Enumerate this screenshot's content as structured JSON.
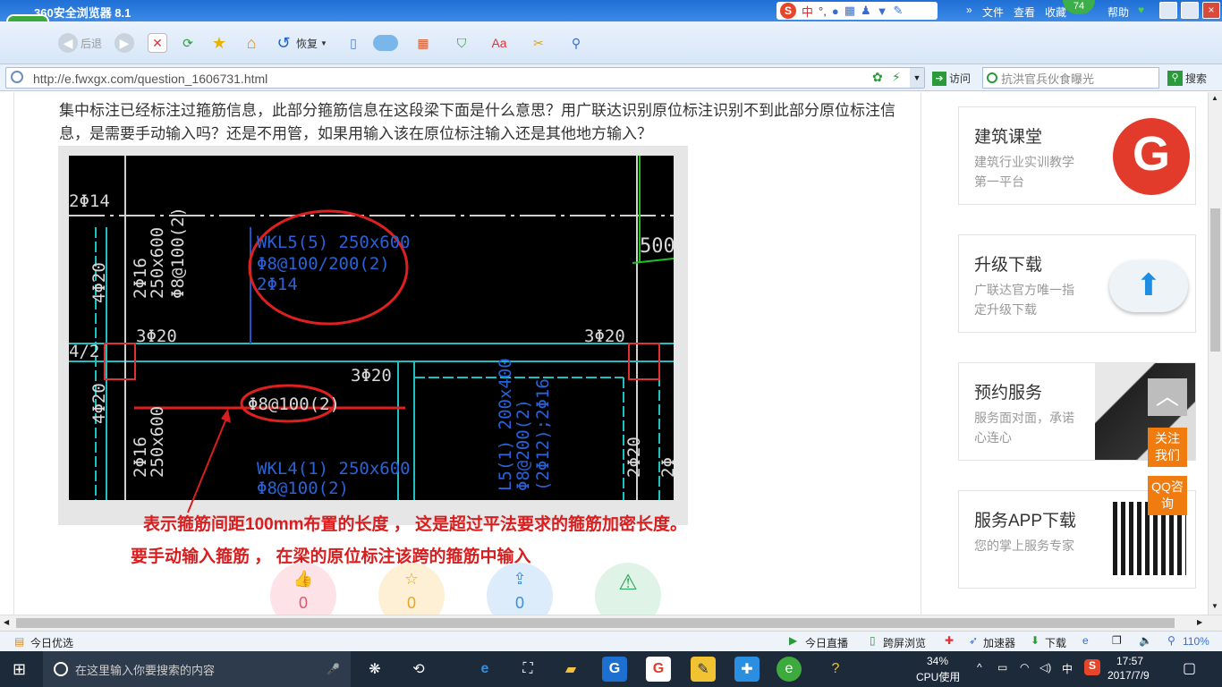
{
  "browser": {
    "title": "360安全浏览器 8.1",
    "menu": [
      "文件",
      "查看",
      "收藏",
      "帮助"
    ],
    "notification_count": "74",
    "ime_label": "中",
    "toolbar": {
      "back": "后退",
      "restore": "恢复"
    },
    "url": "http://e.fwxgx.com/question_1606731.html",
    "visit": "访问",
    "search_placeholder": "抗洪官兵伙食曝光",
    "search_button": "搜索"
  },
  "question": {
    "text": "集中标注已经标注过箍筋信息，此部分箍筋信息在这段梁下面是什么意思？用广联达识别原位标注识别不到此部分原位标注信息，是需要手动输入吗？还是不用管，如果用输入该在原位标注输入还是其他地方输入？"
  },
  "cad": {
    "labels": {
      "l_2d14_top": "2Φ14",
      "l_250x600_v": "250x600",
      "l_2d16_v": "2Φ16",
      "l_d8_100_v": "Φ8@100(2)",
      "l_4d20_left": "4Φ20",
      "l_wkl5": "WKL5(5) 250x600",
      "l_wkl5_st": "Φ8@100/200(2)",
      "l_wkl5_bar": "2Φ14",
      "l_500": "500",
      "l_3d20_a": "3Φ20",
      "l_3d20_b": "3Φ20",
      "l_3d20_c": "3Φ20",
      "l_42": "4/2",
      "l_4d20_b": "4Φ20",
      "l_d8_100_red": "Φ8@100(2)",
      "l_2d16_b": "2Φ16",
      "l_250x600_b": "250x600",
      "l_wkl4": "WKL4(1) 250x600",
      "l_wkl4_st": "Φ8@100(2)",
      "l_l5": "L5(1) 200x400",
      "l_l5_st": "Φ8@200(2)",
      "l_l5_bar": "(2Φ12);2Φ16",
      "l_2d20": "2Φ20",
      "l_2d_r": "2Φ"
    }
  },
  "answer": {
    "line1": "表示箍筋间距100mm布置的长度 ， 这是超过平法要求的箍筋加密长度。",
    "line2": "要手动输入箍筋 ， 在梁的原位标注该跨的箍筋中输入"
  },
  "actions": [
    {
      "icon": "thumbs-up-icon",
      "count": "0",
      "bg": "#fde3e8",
      "fg": "#e0556e"
    },
    {
      "icon": "star-icon",
      "count": "0",
      "bg": "#fdf0d4",
      "fg": "#e6a52a"
    },
    {
      "icon": "share-icon",
      "count": "0",
      "bg": "#dcecfb",
      "fg": "#3b8ee0"
    },
    {
      "icon": "warning-icon",
      "count": "",
      "bg": "#dff4e6",
      "fg": "#2ea35a"
    }
  ],
  "sidebar": [
    {
      "title": "建筑课堂",
      "sub": "建筑行业实训教学第一平台"
    },
    {
      "title": "升级下载",
      "sub": "广联达官方唯一指定升级下载"
    },
    {
      "title": "预约服务",
      "sub": "服务面对面，承诺心连心"
    },
    {
      "title": "服务APP下载",
      "sub": "您的掌上服务专家"
    }
  ],
  "float": {
    "follow": "关注我们",
    "qq": "QQ咨询"
  },
  "status": {
    "left": "今日优选",
    "items": [
      "今日直播",
      "跨屏浏览",
      "加速器",
      "下载"
    ],
    "zoom": "110%"
  },
  "taskbar": {
    "search_placeholder": "在这里输入你要搜索的内容",
    "cpu_pct": "34%",
    "cpu_label": "CPU使用",
    "ime": "中",
    "time": "17:57",
    "date": "2017/7/9"
  },
  "colors": {
    "cad_bg": "#000000",
    "cad_cyan": "#20c0c0",
    "cad_blue": "#1e56c8",
    "annot_red": "#d81e1e",
    "accent_orange": "#f07b0f"
  }
}
